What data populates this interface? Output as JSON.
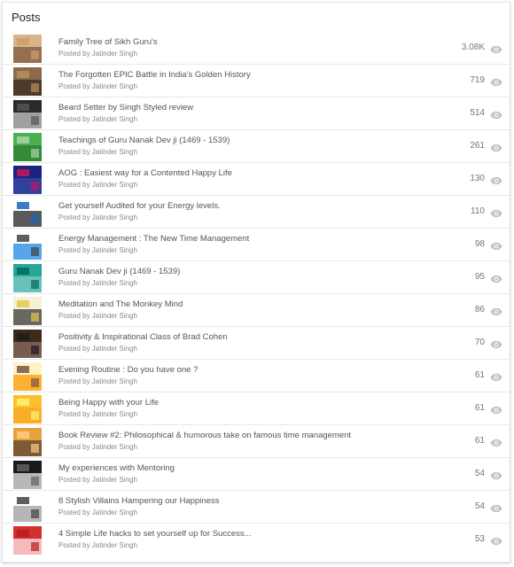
{
  "panel": {
    "title": "Posts"
  },
  "posts": [
    {
      "title": "Family Tree of Sikh Guru's",
      "author": "Posted by Jatinder Singh",
      "views": "3.08K",
      "thumb_colors": [
        "#d9b48a",
        "#7d5a3c",
        "#c9a06a"
      ]
    },
    {
      "title": "The Forgotten EPIC Battle in India's Golden History",
      "author": "Posted by Jatinder Singh",
      "views": "719",
      "thumb_colors": [
        "#8a6a4a",
        "#3b2a1e",
        "#b78f5e"
      ]
    },
    {
      "title": "Beard Setter by Singh Styled review",
      "author": "Posted by Jatinder Singh",
      "views": "514",
      "thumb_colors": [
        "#2a2a2a",
        "#c8c8c8",
        "#555555"
      ]
    },
    {
      "title": "Teachings of Guru Nanak Dev ji (1469 - 1539)",
      "author": "Posted by Jatinder Singh",
      "views": "261",
      "thumb_colors": [
        "#4caf50",
        "#2e7d32",
        "#a5d6a7"
      ]
    },
    {
      "title": "AOG : Easiest way for a Contented Happy Life",
      "author": "Posted by Jatinder Singh",
      "views": "130",
      "thumb_colors": [
        "#1a237e",
        "#3949ab",
        "#c2185b"
      ]
    },
    {
      "title": "Get yourself Audited for your Energy levels.",
      "author": "Posted by Jatinder Singh",
      "views": "110",
      "thumb_colors": [
        "#ffffff",
        "#222222",
        "#1565c0"
      ]
    },
    {
      "title": "Energy Management : The New Time Management",
      "author": "Posted by Jatinder Singh",
      "views": "98",
      "thumb_colors": [
        "#ffffff",
        "#1e88e5",
        "#424242"
      ]
    },
    {
      "title": "Guru Nanak Dev ji (1469 - 1539)",
      "author": "Posted by Jatinder Singh",
      "views": "95",
      "thumb_colors": [
        "#26a69a",
        "#80cbc4",
        "#00695c"
      ]
    },
    {
      "title": "Meditation and The Monkey Mind",
      "author": "Posted by Jatinder Singh",
      "views": "86",
      "thumb_colors": [
        "#f5f0d6",
        "#3a3a3a",
        "#e3c84a"
      ]
    },
    {
      "title": "Positivity & Inspirational Class of Brad Cohen",
      "author": "Posted by Jatinder Singh",
      "views": "70",
      "thumb_colors": [
        "#3e2a1a",
        "#8d6e63",
        "#1c1c1c"
      ]
    },
    {
      "title": "Evening Routine : Do you have one ?",
      "author": "Posted by Jatinder Singh",
      "views": "61",
      "thumb_colors": [
        "#fff3c4",
        "#ff9800",
        "#795548"
      ]
    },
    {
      "title": "Being Happy with your Life",
      "author": "Posted by Jatinder Singh",
      "views": "61",
      "thumb_colors": [
        "#fbc02d",
        "#f9a825",
        "#fff176"
      ]
    },
    {
      "title": "Book Review #2: Philosophical & humorous take on famous time management",
      "author": "Posted by Jatinder Singh",
      "views": "61",
      "thumb_colors": [
        "#e6a23c",
        "#5d4037",
        "#ffcc80"
      ]
    },
    {
      "title": "My experiences with Mentoring",
      "author": "Posted by Jatinder Singh",
      "views": "54",
      "thumb_colors": [
        "#1a1a1a",
        "#eeeeee",
        "#616161"
      ]
    },
    {
      "title": "8 Stylish Villains Hampering our Happiness",
      "author": "Posted by Jatinder Singh",
      "views": "54",
      "thumb_colors": [
        "#ffffff",
        "#9e9e9e",
        "#424242"
      ]
    },
    {
      "title": "4 Simple Life hacks to set yourself up for Success...",
      "author": "Posted by Jatinder Singh",
      "views": "53",
      "thumb_colors": [
        "#d32f2f",
        "#ffebee",
        "#b71c1c"
      ]
    }
  ],
  "icons": {
    "views": "eye-icon",
    "color": "#c4c4c4"
  }
}
